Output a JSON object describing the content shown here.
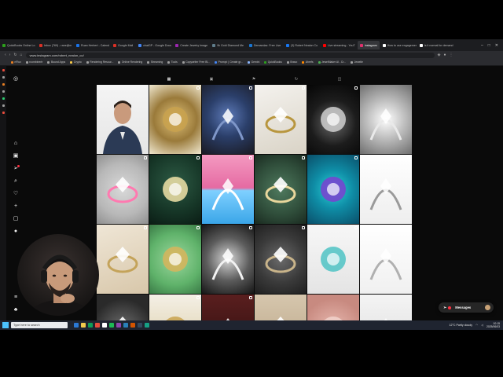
{
  "browser": {
    "tabs": [
      {
        "label": "QuickBooks Online Lo",
        "color": "#2ca01c",
        "active": false
      },
      {
        "label": "Inbox (769) - rane@m",
        "color": "#d93025",
        "active": false
      },
      {
        "label": "Ruan Herbert - Calend",
        "color": "#1a73e8",
        "active": false
      },
      {
        "label": "Google Mail",
        "color": "#d93025",
        "active": false
      },
      {
        "label": "chatGP - Google Docs",
        "color": "#4285f4",
        "active": false
      },
      {
        "label": "Create Jewelry Image",
        "color": "#9c27b0",
        "active": false
      },
      {
        "label": "9k Gold Diamond Me",
        "color": "#607d8b",
        "active": false
      },
      {
        "label": "Demandaz: Free Live",
        "color": "#1976d2",
        "active": false
      },
      {
        "label": "(3) Robert Nealon Co",
        "color": "#1877f2",
        "active": false
      },
      {
        "label": "Live streaming - YouT",
        "color": "#ff0000",
        "active": false
      },
      {
        "label": "instagram",
        "color": "#e1306c",
        "active": true
      },
      {
        "label": "How to use engagement",
        "color": "#ffffff",
        "active": false
      },
      {
        "label": "Is it normal for demand",
        "color": "#ffffff",
        "active": false
      }
    ],
    "url": "www.instagram.com/robert_nealon_co/",
    "bookmarks": [
      {
        "label": "nFlux",
        "color": "#e67e22"
      },
      {
        "label": "rcombinertr",
        "color": "#9e9e9e"
      },
      {
        "label": "Bound Apps",
        "color": "#9e9e9e"
      },
      {
        "label": "Crypto",
        "color": "#f7c948"
      },
      {
        "label": "Rendering Resour...",
        "color": "#9e9e9e"
      },
      {
        "label": "Online Rendering",
        "color": "#9e9e9e"
      },
      {
        "label": "Streaming",
        "color": "#9e9e9e"
      },
      {
        "label": "Tools",
        "color": "#9e9e9e"
      },
      {
        "label": "Copywriter Free Bl...",
        "color": "#9e9e9e"
      },
      {
        "label": "Prompt: | Create gr...",
        "color": "#4285f4"
      },
      {
        "label": "Gemini",
        "color": "#8ab4f8"
      },
      {
        "label": "QuickBooks",
        "color": "#2ca01c"
      },
      {
        "label": "Bravo",
        "color": "#9e9e9e"
      },
      {
        "label": "Ahrefs",
        "color": "#ff8800"
      },
      {
        "label": "JewelMaker Al - Cr...",
        "color": "#4caf50"
      },
      {
        "label": "Jewelle",
        "color": "#9e9e9e"
      }
    ]
  },
  "profile_tabs": [
    "posts-grid",
    "reels",
    "saved",
    "collab",
    "tagged"
  ],
  "posts": [
    {
      "desc": "Portrait of man in dark suit",
      "bg": "linear-gradient(180deg,#f4f4f4 0%,#e6e6e6 100%)",
      "accent": "#2b3a55",
      "badge": false
    },
    {
      "desc": "Gold filigree ring",
      "bg": "radial-gradient(circle at 50% 50%,#e0c27a 0%,#9a7a3a 50%,#f0e8d0 100%)",
      "accent": "#c9a24e",
      "badge": true
    },
    {
      "desc": "Blue sapphire ring",
      "bg": "radial-gradient(circle at 50% 45%,#5d7ab8 0%,#2b3f6a 45%,#1a1a22 100%)",
      "accent": "#7f97c9",
      "badge": true
    },
    {
      "desc": "Gold solitaire ring",
      "bg": "linear-gradient(160deg,#f4f2ee 0%,#d9d3c6 100%)",
      "accent": "#b8963e",
      "badge": true
    },
    {
      "desc": "Diamond earrings on black",
      "bg": "radial-gradient(circle at 50% 55%,#6a6a6a 0%,#1c1c1c 50%,#050505 100%)",
      "accent": "#cfcfcf",
      "badge": true
    },
    {
      "desc": "Close-up diamond",
      "bg": "radial-gradient(circle at 50% 50%,#ffffff 0%,#bdbdbd 45%,#6e6e6e 100%)",
      "accent": "#e9e9e9",
      "badge": false
    },
    {
      "desc": "Logo on white with pink stone",
      "bg": "radial-gradient(circle at 50% 50%,#d9d9d9 0%,#b8b8b8 60%,#8f8f8f 100%)",
      "accent": "#ff79b0",
      "badge": true
    },
    {
      "desc": "Diamond tennis necklace on green",
      "bg": "radial-gradient(circle at 50% 40%,#2d5a44 0%,#163627 60%,#0b1d15 100%)",
      "accent": "#f1e3a8",
      "badge": true
    },
    {
      "desc": "Pink and blue diamonds",
      "bg": "linear-gradient(180deg,#f49ac1 0%,#e56aa2 48%,#7fd0ff 52%,#3aa6e8 100%)",
      "accent": "#ffffff",
      "badge": true
    },
    {
      "desc": "Oval diamond band on green",
      "bg": "radial-gradient(circle at 50% 50%,#4f7a5e 0%,#2f4d3a 60%,#1a2a20 100%)",
      "accent": "#e9d79c",
      "badge": true
    },
    {
      "desc": "Teal and purple gem ring",
      "bg": "radial-gradient(circle at 50% 50%,#2bd1d8 0%,#0f8da6 45%,#0a4f6a 100%)",
      "accent": "#7b3fd0",
      "badge": true
    },
    {
      "desc": "Diamond solitaire on white",
      "bg": "linear-gradient(180deg,#ffffff 0%,#eeeeee 100%)",
      "accent": "#9a9a9a",
      "badge": true
    },
    {
      "desc": "Pear diamond earrings gold",
      "bg": "linear-gradient(160deg,#efe6d6 0%,#d8c7aa 100%)",
      "accent": "#c4a35a",
      "badge": true
    },
    {
      "desc": "Gold ring on green",
      "bg": "radial-gradient(circle at 50% 50%,#9bd79d 0%,#5fb26a 60%,#3a7a46 100%)",
      "accent": "#d8b45a",
      "badge": true
    },
    {
      "desc": "Diamond ring close-up",
      "bg": "radial-gradient(circle at 50% 50%,#d8d8d8 0%,#5c5c5c 50%,#151515 100%)",
      "accent": "#f2f2f2",
      "badge": true
    },
    {
      "desc": "Ring on dark grey",
      "bg": "radial-gradient(circle at 50% 50%,#6a6a6a 0%,#3a3a3a 55%,#1f1f1f 100%)",
      "accent": "#c9b48a",
      "badge": true
    },
    {
      "desc": "Aquamarine halo ring",
      "bg": "linear-gradient(180deg,#f7f7f7 0%,#e4e4e4 100%)",
      "accent": "#4fc3c4",
      "badge": true
    },
    {
      "desc": "Platinum solitaire ring",
      "bg": "linear-gradient(180deg,#ffffff 0%,#f0f0f0 100%)",
      "accent": "#b0b0b0",
      "badge": false
    },
    {
      "desc": "Diamond cluster on dark",
      "bg": "radial-gradient(circle at 50% 50%,#6e6e6e 0%,#2a2a2a 70%)",
      "accent": "#e0e0e0",
      "badge": false
    },
    {
      "desc": "Gold pieces",
      "bg": "linear-gradient(180deg,#f4f0e6 0%,#d8c79c 100%)",
      "accent": "#c9a24e",
      "badge": true
    },
    {
      "desc": "Dark red backdrop",
      "bg": "linear-gradient(180deg,#5a1f1f 0%,#2a0c0c 100%)",
      "accent": "#b85454",
      "badge": true
    },
    {
      "desc": "Beige backdrop",
      "bg": "linear-gradient(180deg,#d6c6ad 0%,#b8a485 100%)",
      "accent": "#9c8560",
      "badge": false
    },
    {
      "desc": "Pink floral",
      "bg": "radial-gradient(circle at 50% 50%,#e8b9b0 0%,#c88a80 70%)",
      "accent": "#f1d2cb",
      "badge": false
    },
    {
      "desc": "Diamond on white",
      "bg": "linear-gradient(180deg,#f4f4f4 0%,#dcdcdc 100%)",
      "accent": "#a0a0a0",
      "badge": false
    }
  ],
  "messages": {
    "label": "Messages"
  },
  "taskbar": {
    "search_placeholder": "Type here to search",
    "weather": "12°C  Partly cloudy",
    "time": "10:15",
    "date": "2025/06/03"
  }
}
